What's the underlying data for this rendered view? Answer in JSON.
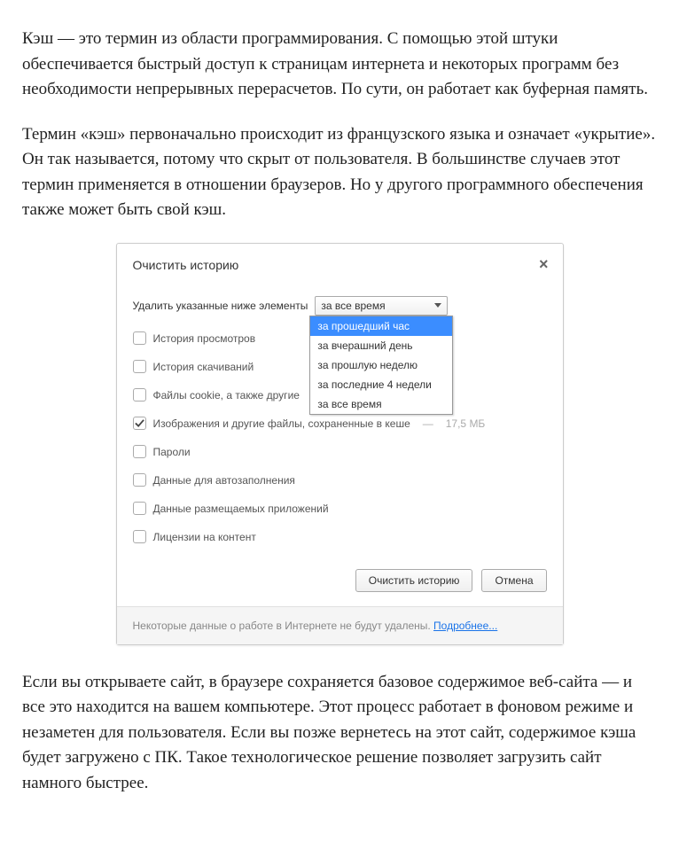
{
  "article": {
    "para1": "Кэш — это термин из области программирования. С помощью этой штуки обеспечивается быстрый доступ к страницам интернета и некоторых программ без необходимости непрерывных перерасчетов. По сути, он работает как буферная память.",
    "para2": "Термин «кэш» первоначально происходит из французского языка и означает «укрытие». Он так называется, потому что скрыт от пользователя. В большинстве случаев этот термин применяется в отношении браузеров. Но у другого программного обеспечения также может быть свой кэш.",
    "para3": "Если вы открываете сайт, в браузере сохраняется базовое содержимое веб-сайта — и все это находится на вашем компьютере. Этот процесс работает в фоновом режиме и незаметен для пользователя. Если вы позже вернетесь на этот сайт, содержимое кэша будет загружено с ПК. Такое технологическое решение позволяет загрузить сайт намного быстрее."
  },
  "dialog": {
    "title": "Очистить историю",
    "close": "×",
    "instruction": "Удалить указанные ниже элементы",
    "dropdown_selected": "за все время",
    "dropdown_options": {
      "opt0": "за прошедший час",
      "opt1": "за вчерашний день",
      "opt2": "за прошлую неделю",
      "opt3": "за последние 4 недели",
      "opt4": "за все время"
    },
    "checks": {
      "history": "История просмотров",
      "downloads": "История скачиваний",
      "cookies": "Файлы cookie, а также другие",
      "cache": "Изображения и другие файлы, сохраненные в кеше",
      "cache_size_sep": "—",
      "cache_size": "17,5 МБ",
      "passwords": "Пароли",
      "autofill": "Данные для автозаполнения",
      "hosted": "Данные размещаемых приложений",
      "licenses": "Лицензии на контент"
    },
    "actions": {
      "clear": "Очистить историю",
      "cancel": "Отмена"
    },
    "footer_text": "Некоторые данные о работе в Интернете не будут удалены. ",
    "footer_link": "Подробнее..."
  }
}
